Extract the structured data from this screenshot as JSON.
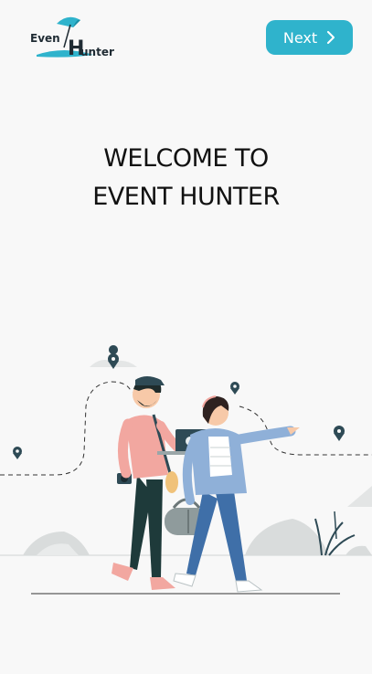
{
  "header": {
    "logo": {
      "line1": "Even",
      "line2": "unter",
      "icon": "umbrella-icon"
    },
    "next_label": "Next",
    "next_icon": "chevron-right-icon"
  },
  "welcome": {
    "line1": "WELCOME TO",
    "line2": "EVENT HUNTER"
  },
  "colors": {
    "accent": "#2fb3cc",
    "background": "#f8f8f8",
    "text": "#111111"
  }
}
